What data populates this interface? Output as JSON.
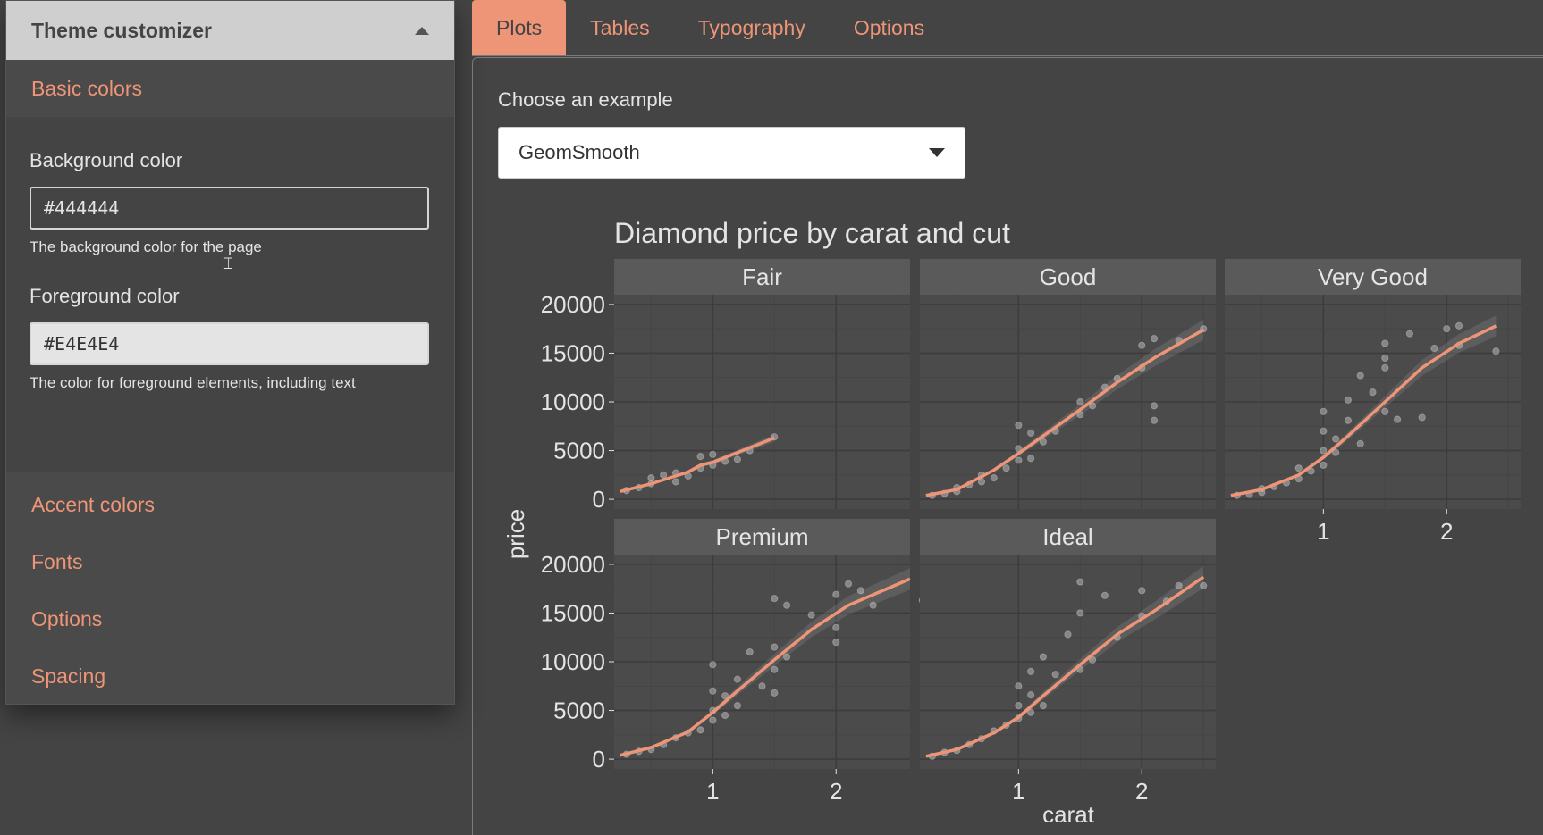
{
  "sidebar": {
    "title": "Theme customizer",
    "sections": [
      "Basic colors",
      "Accent colors",
      "Fonts",
      "Options",
      "Spacing"
    ],
    "background": {
      "label": "Background color",
      "value": "#444444",
      "help": "The background color for the page"
    },
    "foreground": {
      "label": "Foreground color",
      "value": "#E4E4E4",
      "help": "The color for foreground elements, including text"
    }
  },
  "tabs": [
    "Plots",
    "Tables",
    "Typography",
    "Options"
  ],
  "example": {
    "label": "Choose an example",
    "selected": "GeomSmooth"
  },
  "colors": {
    "background": "#444444",
    "foreground": "#E4E4E4",
    "accent": "#EE9577"
  },
  "chart_data": {
    "type": "scatter",
    "title": "Diamond price by carat and cut",
    "xlabel": "carat",
    "ylabel": "price",
    "xlim": [
      0.2,
      2.6
    ],
    "ylim": [
      -1000,
      21000
    ],
    "yticks": [
      0,
      5000,
      10000,
      15000,
      20000
    ],
    "xticks": [
      1,
      2
    ],
    "grid": true,
    "facets": [
      {
        "name": "Fair",
        "smooth": [
          [
            0.25,
            800
          ],
          [
            0.5,
            1600
          ],
          [
            0.8,
            2800
          ],
          [
            0.9,
            3500
          ],
          [
            1.0,
            3800
          ],
          [
            1.2,
            4800
          ],
          [
            1.5,
            6300
          ]
        ],
        "points": [
          [
            0.3,
            900
          ],
          [
            0.4,
            1200
          ],
          [
            0.5,
            1600
          ],
          [
            0.5,
            2200
          ],
          [
            0.6,
            2500
          ],
          [
            0.7,
            1800
          ],
          [
            0.7,
            2700
          ],
          [
            0.8,
            2400
          ],
          [
            0.9,
            3200
          ],
          [
            0.9,
            4400
          ],
          [
            1.0,
            3500
          ],
          [
            1.0,
            4600
          ],
          [
            1.1,
            3900
          ],
          [
            1.2,
            4100
          ],
          [
            1.3,
            5000
          ],
          [
            1.5,
            6400
          ]
        ]
      },
      {
        "name": "Good",
        "smooth": [
          [
            0.25,
            400
          ],
          [
            0.5,
            1000
          ],
          [
            0.8,
            3000
          ],
          [
            1.0,
            4700
          ],
          [
            1.2,
            6500
          ],
          [
            1.5,
            9200
          ],
          [
            1.8,
            12000
          ],
          [
            2.1,
            14500
          ],
          [
            2.5,
            17400
          ]
        ],
        "points": [
          [
            0.3,
            400
          ],
          [
            0.4,
            600
          ],
          [
            0.5,
            800
          ],
          [
            0.5,
            1200
          ],
          [
            0.6,
            1500
          ],
          [
            0.7,
            1800
          ],
          [
            0.7,
            2500
          ],
          [
            0.8,
            2200
          ],
          [
            0.9,
            3200
          ],
          [
            1.0,
            4000
          ],
          [
            1.0,
            5200
          ],
          [
            1.0,
            7600
          ],
          [
            1.1,
            6800
          ],
          [
            1.1,
            4200
          ],
          [
            1.2,
            5900
          ],
          [
            1.3,
            7000
          ],
          [
            1.5,
            10000
          ],
          [
            1.5,
            8700
          ],
          [
            1.6,
            9600
          ],
          [
            1.7,
            11500
          ],
          [
            1.8,
            12400
          ],
          [
            2.0,
            13500
          ],
          [
            2.0,
            15800
          ],
          [
            2.1,
            8100
          ],
          [
            2.1,
            9600
          ],
          [
            2.1,
            16500
          ],
          [
            2.3,
            16300
          ],
          [
            2.5,
            17500
          ]
        ]
      },
      {
        "name": "Very Good",
        "smooth": [
          [
            0.25,
            400
          ],
          [
            0.5,
            1000
          ],
          [
            0.8,
            2500
          ],
          [
            1.0,
            4300
          ],
          [
            1.2,
            6500
          ],
          [
            1.5,
            10000
          ],
          [
            1.8,
            13500
          ],
          [
            2.1,
            16000
          ],
          [
            2.4,
            17800
          ]
        ],
        "points": [
          [
            0.3,
            400
          ],
          [
            0.4,
            500
          ],
          [
            0.5,
            700
          ],
          [
            0.5,
            1100
          ],
          [
            0.6,
            1300
          ],
          [
            0.7,
            1700
          ],
          [
            0.8,
            2100
          ],
          [
            0.8,
            3200
          ],
          [
            0.9,
            2900
          ],
          [
            1.0,
            3500
          ],
          [
            1.0,
            5000
          ],
          [
            1.0,
            7000
          ],
          [
            1.0,
            9000
          ],
          [
            1.1,
            4800
          ],
          [
            1.1,
            6200
          ],
          [
            1.2,
            8100
          ],
          [
            1.2,
            10200
          ],
          [
            1.3,
            5700
          ],
          [
            1.3,
            12700
          ],
          [
            1.4,
            11000
          ],
          [
            1.5,
            9000
          ],
          [
            1.5,
            13500
          ],
          [
            1.5,
            14500
          ],
          [
            1.5,
            16000
          ],
          [
            1.6,
            8200
          ],
          [
            1.7,
            17000
          ],
          [
            1.8,
            8400
          ],
          [
            1.9,
            15500
          ],
          [
            2.0,
            17500
          ],
          [
            2.1,
            17800
          ],
          [
            2.1,
            15800
          ],
          [
            2.4,
            15200
          ]
        ]
      },
      {
        "name": "Premium",
        "smooth": [
          [
            0.25,
            400
          ],
          [
            0.5,
            1200
          ],
          [
            0.8,
            2800
          ],
          [
            1.0,
            4800
          ],
          [
            1.2,
            7000
          ],
          [
            1.5,
            10200
          ],
          [
            1.8,
            13300
          ],
          [
            2.1,
            15800
          ],
          [
            2.6,
            18500
          ]
        ],
        "points": [
          [
            0.3,
            500
          ],
          [
            0.4,
            800
          ],
          [
            0.5,
            1000
          ],
          [
            0.6,
            1500
          ],
          [
            0.7,
            2200
          ],
          [
            0.8,
            2700
          ],
          [
            0.9,
            3000
          ],
          [
            1.0,
            4000
          ],
          [
            1.0,
            5000
          ],
          [
            1.0,
            7000
          ],
          [
            1.0,
            9700
          ],
          [
            1.1,
            4500
          ],
          [
            1.1,
            6500
          ],
          [
            1.2,
            5500
          ],
          [
            1.2,
            8200
          ],
          [
            1.3,
            11000
          ],
          [
            1.4,
            7500
          ],
          [
            1.5,
            9200
          ],
          [
            1.5,
            6800
          ],
          [
            1.5,
            11500
          ],
          [
            1.5,
            16500
          ],
          [
            1.6,
            10500
          ],
          [
            1.6,
            15800
          ],
          [
            1.8,
            14800
          ],
          [
            2.0,
            13500
          ],
          [
            2.0,
            12000
          ],
          [
            2.0,
            16900
          ],
          [
            2.1,
            18000
          ],
          [
            2.2,
            17300
          ],
          [
            2.3,
            15800
          ],
          [
            2.7,
            16300
          ]
        ]
      },
      {
        "name": "Ideal",
        "smooth": [
          [
            0.25,
            300
          ],
          [
            0.5,
            1000
          ],
          [
            0.8,
            2700
          ],
          [
            1.0,
            4300
          ],
          [
            1.2,
            6500
          ],
          [
            1.5,
            9700
          ],
          [
            1.8,
            12800
          ],
          [
            2.1,
            15200
          ],
          [
            2.5,
            18700
          ]
        ],
        "points": [
          [
            0.3,
            300
          ],
          [
            0.4,
            700
          ],
          [
            0.5,
            900
          ],
          [
            0.6,
            1500
          ],
          [
            0.7,
            2100
          ],
          [
            0.8,
            2900
          ],
          [
            0.9,
            3500
          ],
          [
            1.0,
            4200
          ],
          [
            1.0,
            5500
          ],
          [
            1.0,
            7500
          ],
          [
            1.1,
            4800
          ],
          [
            1.1,
            6600
          ],
          [
            1.1,
            9000
          ],
          [
            1.2,
            5500
          ],
          [
            1.2,
            10500
          ],
          [
            1.3,
            8700
          ],
          [
            1.4,
            12800
          ],
          [
            1.5,
            9200
          ],
          [
            1.5,
            15000
          ],
          [
            1.5,
            18200
          ],
          [
            1.6,
            10200
          ],
          [
            1.7,
            16800
          ],
          [
            1.8,
            12500
          ],
          [
            2.0,
            14700
          ],
          [
            2.0,
            17300
          ],
          [
            2.2,
            16200
          ],
          [
            2.3,
            17800
          ],
          [
            2.5,
            17800
          ]
        ]
      }
    ]
  }
}
